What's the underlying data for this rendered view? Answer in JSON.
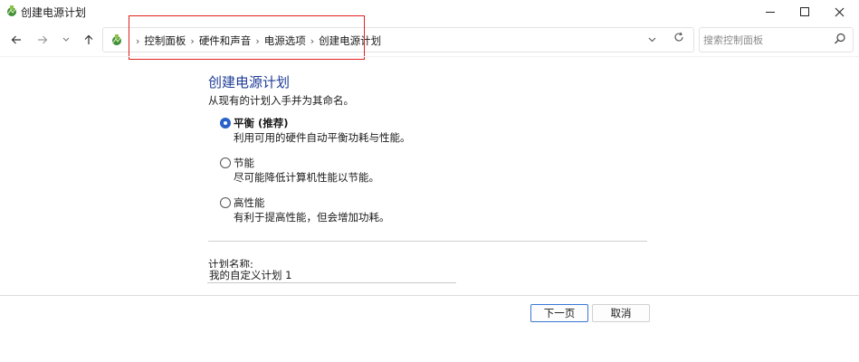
{
  "window": {
    "title": "创建电源计划",
    "controls": {
      "minimize": "minimize",
      "maximize": "maximize",
      "close": "close"
    }
  },
  "navigation": {
    "back_icon": "arrow-left-icon",
    "forward_icon": "arrow-right-icon",
    "recent_icon": "chevron-down-icon",
    "up_icon": "arrow-up-icon",
    "breadcrumbs": [
      "控制面板",
      "硬件和声音",
      "电源选项",
      "创建电源计划"
    ],
    "refresh_icon": "refresh-icon",
    "search": {
      "placeholder": "搜索控制面板",
      "value": ""
    }
  },
  "content": {
    "title": "创建电源计划",
    "description": "从现有的计划入手并为其命名。",
    "options": [
      {
        "name": "平衡 (推荐)",
        "description": "利用可用的硬件自动平衡功耗与性能。",
        "selected": true
      },
      {
        "name": "节能",
        "description": "尽可能降低计算机性能以节能。",
        "selected": false
      },
      {
        "name": "高性能",
        "description": "有利于提高性能，但会增加功耗。",
        "selected": false
      }
    ],
    "plan_name_label": "计划名称:",
    "plan_name_value": "我的自定义计划 1"
  },
  "footer": {
    "next_label": "下一页",
    "cancel_label": "取消"
  },
  "colors": {
    "title_blue": "#1e3c96",
    "accent": "#2a62c9",
    "highlight_red": "#e02020"
  }
}
